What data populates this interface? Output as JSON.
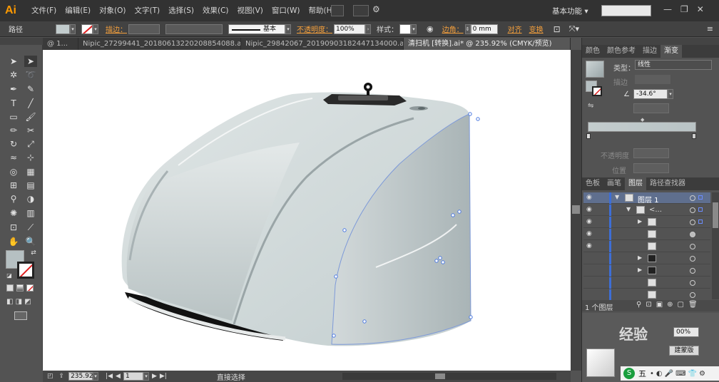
{
  "app": {
    "logo": "Ai",
    "workspace": "基本功能",
    "workspace_arrow": "▾"
  },
  "menus": [
    "文件(F)",
    "编辑(E)",
    "对象(O)",
    "文字(T)",
    "选择(S)",
    "效果(C)",
    "视图(V)",
    "窗口(W)",
    "帮助(H)"
  ],
  "window_controls": [
    "—",
    "❐",
    "✕"
  ],
  "controlbar": {
    "selection_type": "路径",
    "stroke_label": "描边：",
    "stroke_style": "基本",
    "opacity_label": "不透明度：",
    "opacity_value": "100%",
    "style_label": "样式：",
    "corner_label": "边角：",
    "corner_value": "0 mm",
    "align_label": "对齐",
    "transform_label": "变换"
  },
  "tabs": [
    {
      "label": "@ 1...",
      "active": false
    },
    {
      "label": "Nipic_27299441_20180613220208854088.ai*",
      "active": false
    },
    {
      "label": "Nipic_29842067_20190903182447134000.ai*",
      "active": false
    },
    {
      "label": "清扫机 [转换].ai* @ 235.92% (CMYK/预览)",
      "active": true
    }
  ],
  "statusbar": {
    "zoom": "235.92",
    "artboard": "1",
    "tool": "直接选择"
  },
  "gradient_panel": {
    "tabs": [
      {
        "label": "颜色",
        "active": false
      },
      {
        "label": "颜色参考",
        "active": false
      },
      {
        "label": "描边",
        "active": false
      },
      {
        "label": "渐变",
        "active": true
      }
    ],
    "type_label": "类型：",
    "type_value": "线性",
    "stroke_label": "描边",
    "angle_value": "-34.6°",
    "opacity_label": "不透明度",
    "position_label": "位置"
  },
  "layers_panel": {
    "tabs": [
      {
        "label": "色板",
        "active": false
      },
      {
        "label": "画笔",
        "active": false
      },
      {
        "label": "图层",
        "active": true
      },
      {
        "label": "路径查找器",
        "active": false
      }
    ],
    "layer_name": "图层 1",
    "sublayer_name": "<...",
    "footer": "1 个图层"
  },
  "overlay": {
    "transparency_value": "00%",
    "mask_button": "建蒙版",
    "tray_text": "五",
    "watermark": "经验"
  },
  "colors": {
    "accent_orange": "#f5a03c",
    "selection_blue": "#3d6ed6",
    "body_gray": "#c5cfd0"
  }
}
